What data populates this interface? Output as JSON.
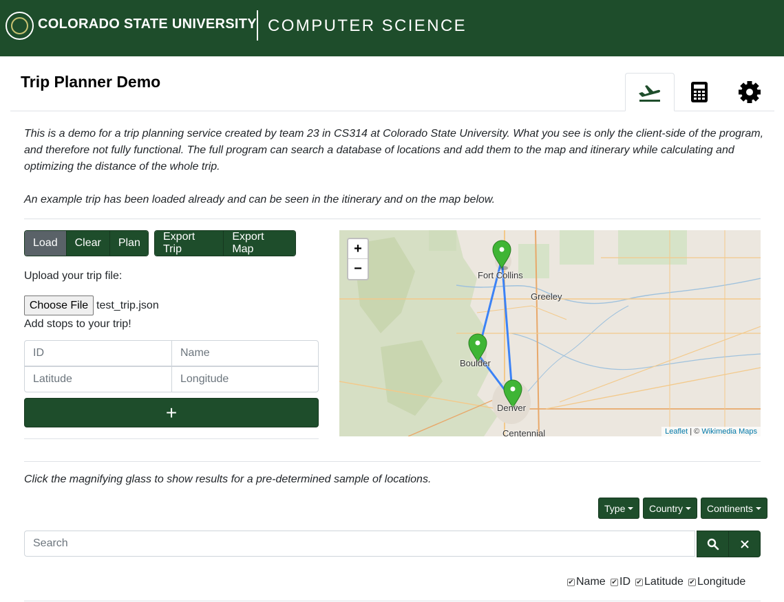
{
  "header": {
    "university": "COLORADO STATE UNIVERSITY",
    "department": "COMPUTER SCIENCE"
  },
  "page": {
    "title": "Trip Planner Demo",
    "tabs": [
      {
        "icon": "airplane-departure-icon",
        "active": true
      },
      {
        "icon": "calculator-icon",
        "active": false
      },
      {
        "icon": "gear-icon",
        "active": false
      }
    ]
  },
  "intro": {
    "paragraph1": "This is a demo for a trip planning service created by team 23 in CS314 at Colorado State University. What you see is only the client-side of the program, and therefore not fully functional. The full program can search a database of locations and add them to the map and itinerary while calculating and optimizing the distance of the whole trip.",
    "paragraph2": "An example trip has been loaded already and can be seen in the itinerary and on the map below."
  },
  "trip_controls": {
    "load_label": "Load",
    "clear_label": "Clear",
    "plan_label": "Plan",
    "export_trip_label": "Export Trip",
    "export_map_label": "Export Map"
  },
  "upload": {
    "label": "Upload your trip file:",
    "choose_file_label": "Choose File",
    "file_name": "test_trip.json"
  },
  "add_stops": {
    "label": "Add stops to your trip!",
    "id_placeholder": "ID",
    "name_placeholder": "Name",
    "latitude_placeholder": "Latitude",
    "longitude_placeholder": "Longitude",
    "add_label": "+"
  },
  "map": {
    "zoom_in": "+",
    "zoom_out": "−",
    "attribution_leaflet": "Leaflet",
    "attribution_sep": " | © ",
    "attribution_tiles": "Wikimedia Maps",
    "cities": [
      "Fort Collins",
      "Greeley",
      "Boulder",
      "Denver",
      "Centennial"
    ],
    "marker_color": "#3fb535",
    "route_color": "#3b82f6"
  },
  "search": {
    "hint": "Click the magnifying glass to show results for a pre-determined sample of locations.",
    "filters": [
      "Type",
      "Country",
      "Continents"
    ],
    "placeholder": "Search",
    "columns": [
      "Name",
      "ID",
      "Latitude",
      "Longitude"
    ]
  },
  "colors": {
    "brand_green": "#1e4d2b",
    "selected_gray": "#5a6268"
  }
}
